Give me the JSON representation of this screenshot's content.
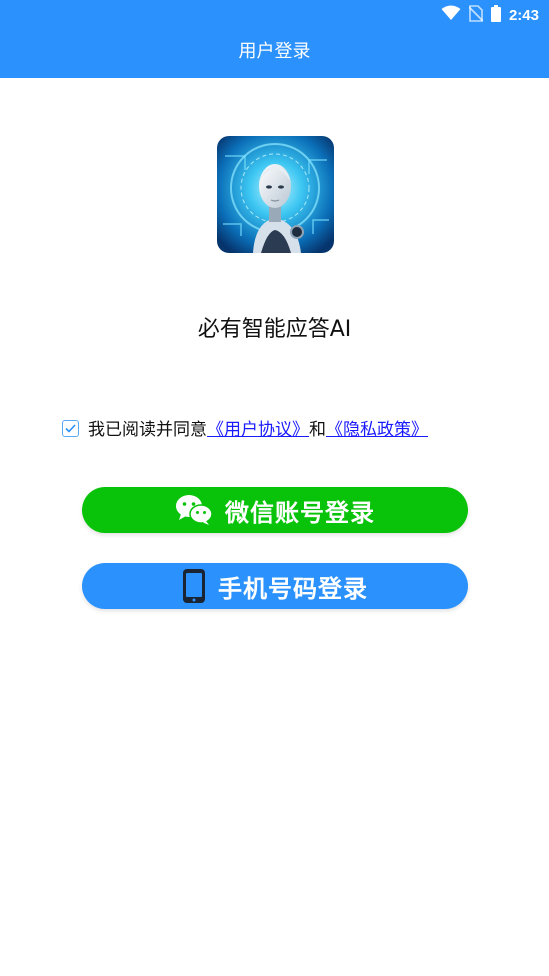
{
  "status_bar": {
    "time": "2:43",
    "icons": [
      "wifi-icon",
      "no-sim-icon",
      "battery-icon"
    ]
  },
  "header": {
    "title": "用户登录"
  },
  "app": {
    "logo_icon": "robot-logo",
    "name": "必有智能应答AI"
  },
  "agreement": {
    "checked": true,
    "prefix": "我已阅读并同意",
    "user_agreement": "《用户协议》",
    "conjunction": "和",
    "privacy_policy": "《隐私政策》"
  },
  "buttons": {
    "wechat_label": "微信账号登录",
    "phone_label": "手机号码登录"
  },
  "colors": {
    "primary": "#2b91fc",
    "wechat": "#09c20a",
    "link": "#1a1aff"
  }
}
